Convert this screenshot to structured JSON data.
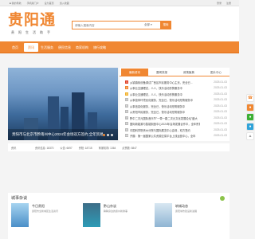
{
  "topbar": {
    "links": [
      "■ 我的导航",
      "手机版门户",
      "设为首页",
      "加入收藏"
    ],
    "right": [
      "登录",
      "注册"
    ]
  },
  "header": {
    "logo_main": "贵阳通",
    "logo_sub": "贵阳生活助手",
    "search_placeholder": "请输入搜索内容",
    "search_category": "全部 ▾",
    "search_button": "搜索"
  },
  "nav": {
    "items": [
      "首页",
      "资讯",
      "生活服务",
      "便民信息",
      "商家机构",
      "旅行攻略"
    ],
    "active_index": 1
  },
  "slider": {
    "caption": "贵阳市与北京市黔南州中心2024年会场双方签约,全年贸易",
    "colors": {
      "accent": "#f08732"
    }
  },
  "news": {
    "tabs": [
      "最新资讯",
      "要闻快报",
      "政策聚焦",
      "图片中心"
    ],
    "active_tab": 0,
    "items": [
      {
        "num": "1",
        "title": "乡镇镇街设备调试广西区市民服务中心主页，完全已...",
        "date": "2025-01-03"
      },
      {
        "num": "2",
        "title": "从事业交通理念，人人，快乐活动形势服务中",
        "date": "2025-01-03"
      },
      {
        "num": "3",
        "title": "从事业交通理念，人人，快乐活动形势服务中",
        "date": "2025-01-03"
      },
      {
        "num": "4",
        "title": "从事营商环境优化服务，完全已，快乐活动形势服务中",
        "date": "2025-01-03"
      },
      {
        "num": "5",
        "title": "从事信息化服务，完全已，快乐活动形势服务中",
        "date": "2025-01-03"
      },
      {
        "num": "6",
        "title": "从贵阳市民服务，完全已，快乐活动形势服务中",
        "date": "2025-01-03"
      },
      {
        "num": "7",
        "title": "黔中二次元国际音乐节\"一带一路二次元文化发展论坛\"盛大",
        "date": "2025-01-03"
      },
      {
        "num": "8",
        "title": "国际新能源与智能制造中心2024年会场发展合作中，全年贸易",
        "date": "2025-01-03"
      },
      {
        "num": "9",
        "title": "中国科学院贵州分院与国际展览中心会场，双方签约",
        "date": "2025-01-03"
      },
      {
        "num": "10",
        "title": "开展：第一届国家公共资源交易平台上线运营中心，全年",
        "date": "2025-01-03"
      }
    ]
  },
  "statbar": {
    "items": [
      "资讯",
      "资讯信息: 18370",
      "公告: 6697",
      "贵阳: 18715",
      "商家机构: 1364",
      "点赞数: 5847"
    ]
  },
  "float_icons": [
    "phone-icon",
    "qq-icon",
    "wechat-icon",
    "weibo-icon",
    "top-icon"
  ],
  "city": {
    "title": "城事杂谈",
    "cards": [
      {
        "name": "今日贵阳",
        "desc": "贵阳市全新城区生活资讯"
      },
      {
        "name": "黔山杂谈",
        "desc": "聊聊身边的贵州新鲜事"
      },
      {
        "name": "筑城动态",
        "desc": "贵阳城市建设新进展"
      }
    ]
  }
}
